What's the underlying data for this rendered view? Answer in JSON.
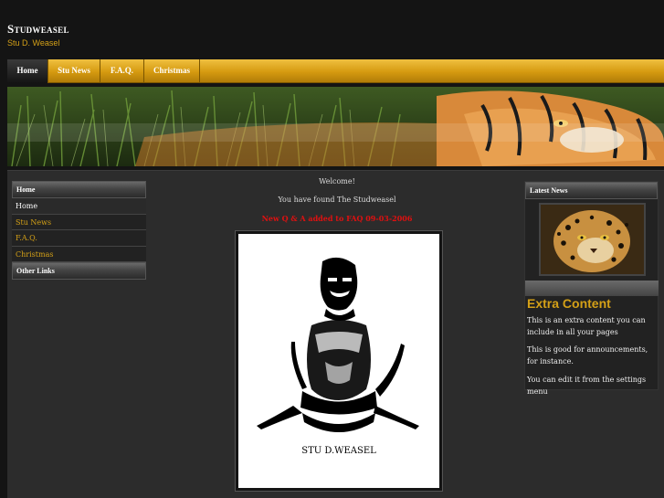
{
  "header": {
    "title": "Studweasel",
    "slogan": "Stu D. Weasel"
  },
  "nav": {
    "items": [
      {
        "label": "Home",
        "active": true
      },
      {
        "label": "Stu News",
        "active": false
      },
      {
        "label": "F.A.Q.",
        "active": false
      },
      {
        "label": "Christmas",
        "active": false
      }
    ]
  },
  "sidebar_left": {
    "home_block_title": "Home",
    "menu": [
      {
        "label": "Home"
      },
      {
        "label": "Stu News"
      },
      {
        "label": "F.A.Q."
      },
      {
        "label": "Christmas"
      }
    ],
    "other_links_title": "Other Links"
  },
  "main": {
    "welcome": "Welcome!",
    "found": "You have found The Studweasel",
    "new_qa": "New Q & A added to FAQ 09-03-2006",
    "image_caption": "STU D.WEASEL"
  },
  "sidebar_right": {
    "latest_news_title": "Latest News",
    "extra_title": "Extra Content",
    "extra_p1": "This is an extra content you can include in all your pages",
    "extra_p2": "This is good for announcements, for instance.",
    "extra_p3": "You can edit it from the settings menu"
  },
  "colors": {
    "accent": "#d4a017",
    "background": "#141414",
    "alert": "#e01010"
  }
}
